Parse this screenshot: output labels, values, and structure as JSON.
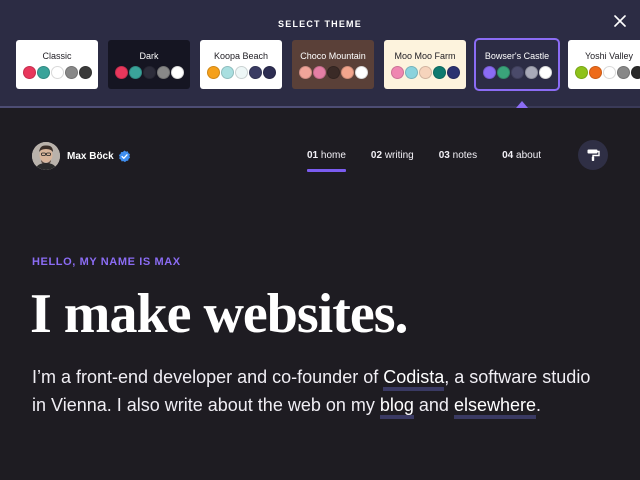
{
  "theme_picker": {
    "title": "SELECT THEME",
    "themes": [
      {
        "name": "Classic",
        "bg": "#ffffff",
        "fg": "#1e1c22",
        "swatches": [
          "#e8375c",
          "#3aa39a",
          "#ffffff",
          "#888888",
          "#3a3a3a"
        ]
      },
      {
        "name": "Dark",
        "bg": "#151522",
        "fg": "#ffffff",
        "swatches": [
          "#e8375c",
          "#3aa39a",
          "#2c2c3a",
          "#888888",
          "#ffffff"
        ]
      },
      {
        "name": "Koopa Beach",
        "bg": "#ffffff",
        "fg": "#1e1c22",
        "swatches": [
          "#f5a01a",
          "#a9dfe0",
          "#eef7f7",
          "#3a3c63",
          "#2d2d52"
        ]
      },
      {
        "name": "Choco Mountain",
        "bg": "#5a4038",
        "fg": "#ffffff",
        "swatches": [
          "#f0a59a",
          "#e57fa5",
          "#3a2a26",
          "#f2a58d",
          "#ffffff"
        ]
      },
      {
        "name": "Moo Moo Farm",
        "bg": "#fdf3dd",
        "fg": "#1e1c22",
        "swatches": [
          "#ef87b1",
          "#8ad3dd",
          "#f6d4bc",
          "#0e7a6f",
          "#2b3270"
        ]
      },
      {
        "name": "Bowser's Castle",
        "bg": "#2c2c44",
        "fg": "#ffffff",
        "swatches": [
          "#8b6cf4",
          "#3aa37a",
          "#4a4a6a",
          "#a9aab8",
          "#ffffff"
        ]
      },
      {
        "name": "Yoshi Valley",
        "bg": "#ffffff",
        "fg": "#1e1c22",
        "swatches": [
          "#8ec21a",
          "#ee6b1a",
          "#ffffff",
          "#888888",
          "#2a2a2a"
        ]
      }
    ],
    "selected_index": 5
  },
  "header": {
    "name": "Max Böck",
    "nav": [
      {
        "num": "01",
        "label": "home"
      },
      {
        "num": "02",
        "label": "writing"
      },
      {
        "num": "03",
        "label": "notes"
      },
      {
        "num": "04",
        "label": "about"
      }
    ]
  },
  "hero": {
    "greeting": "HELLO, MY NAME IS MAX",
    "headline": "I make websites.",
    "intro_1": "I’m a front-end developer and co-founder of ",
    "link_codista": "Codista",
    "intro_2": ", a software studio in Vienna. I also write about the web on my ",
    "link_blog": "blog",
    "intro_3": " and ",
    "link_elsewhere": "elsewhere",
    "intro_4": "."
  },
  "colors": {
    "accent": "#8b6cf4",
    "background": "#1e1c22",
    "panel": "#2c2c44"
  }
}
